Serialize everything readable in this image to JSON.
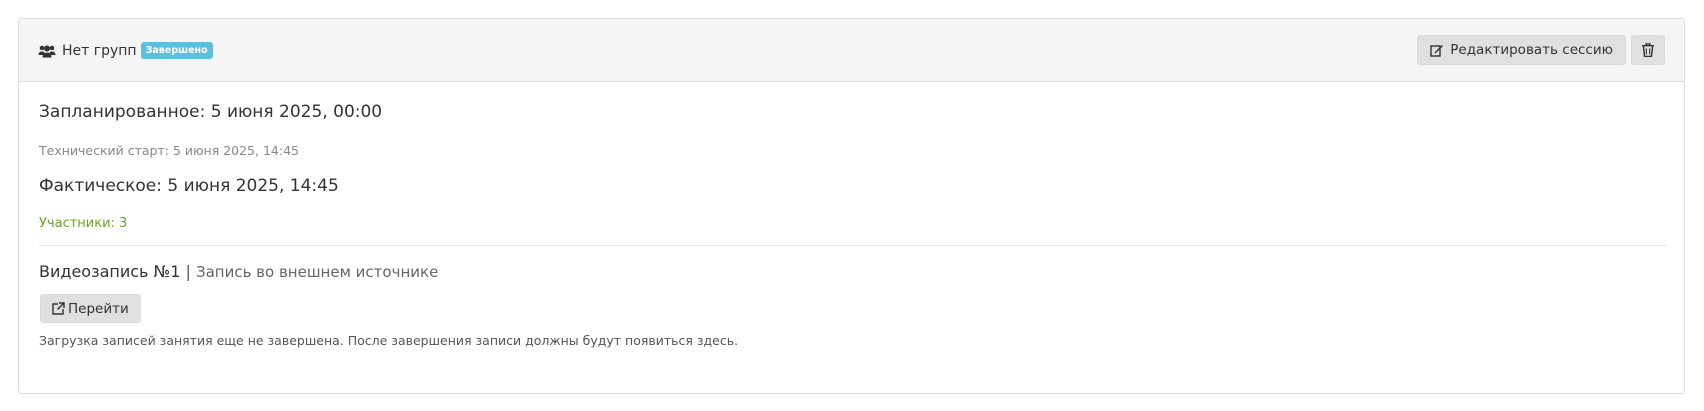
{
  "header": {
    "groups_text": "Нет групп",
    "status_badge": "Завершено",
    "edit_button_label": "Редактировать сессию"
  },
  "schedule": {
    "planned": "Запланированное: 5 июня 2025, 00:00",
    "technical_start": "Технический старт: 5 июня 2025, 14:45",
    "actual": "Фактическое: 5 июня 2025, 14:45",
    "participants": "Участники: 3"
  },
  "recording": {
    "title": "Видеозапись №1",
    "separator": "|",
    "subtitle": "Запись во внешнем источнике",
    "goto_label": "Перейти",
    "notice": "Загрузка записей занятия еще не завершена. После завершения записи должны будут появиться здесь."
  },
  "colors": {
    "badge": "#5bc0de",
    "participants": "#6aa428",
    "heading_bg": "#f5f5f5",
    "button_bg": "#e0e0e0"
  },
  "icons": [
    "users-icon",
    "edit-icon",
    "trash-icon",
    "external-link-icon"
  ]
}
